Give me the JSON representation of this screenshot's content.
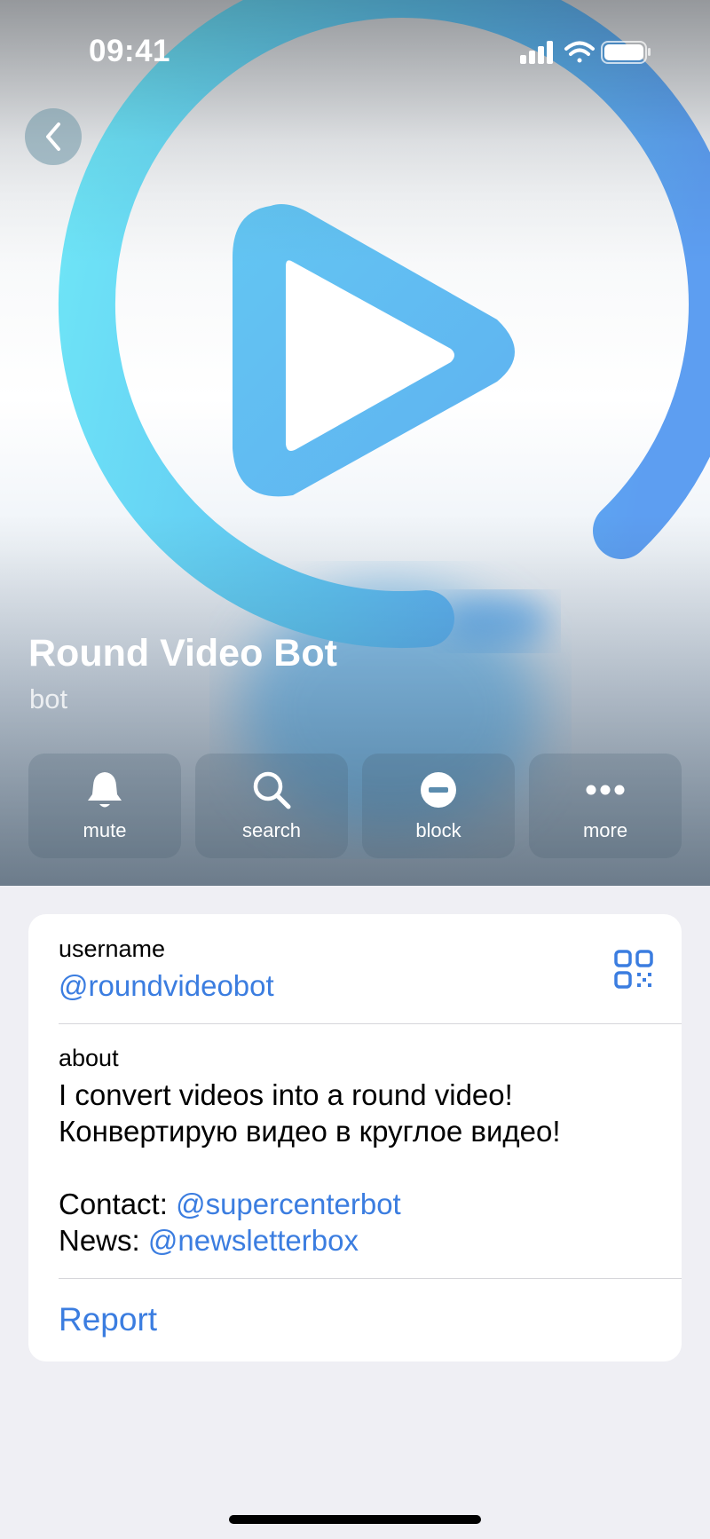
{
  "status_bar": {
    "time": "09:41",
    "icons": [
      "signal-icon",
      "wifi-icon",
      "battery-icon"
    ]
  },
  "header": {
    "back_icon": "chevron-left-icon",
    "title": "Round Video Bot",
    "subtitle": "bot",
    "avatar_icon": "play-circle-icon"
  },
  "actions": [
    {
      "label": "mute",
      "icon": "bell-icon"
    },
    {
      "label": "search",
      "icon": "magnifier-icon"
    },
    {
      "label": "block",
      "icon": "block-icon"
    },
    {
      "label": "more",
      "icon": "ellipsis-icon"
    }
  ],
  "info": {
    "username_label": "username",
    "username_value": "@roundvideobot",
    "qr_icon": "qr-code-icon",
    "about_label": "about",
    "about_line1": "I convert videos into a round video!",
    "about_line2": "Конвертирую видео в круглое видео!",
    "contact_prefix": "Contact: ",
    "contact_link": "@supercenterbot",
    "news_prefix": "News: ",
    "news_link": "@newsletterbox",
    "report_label": "Report"
  },
  "colors": {
    "accent": "#3b7de0",
    "background": "#efeff4",
    "ring_start": "#6ae3f6",
    "ring_end": "#5a9df0"
  }
}
